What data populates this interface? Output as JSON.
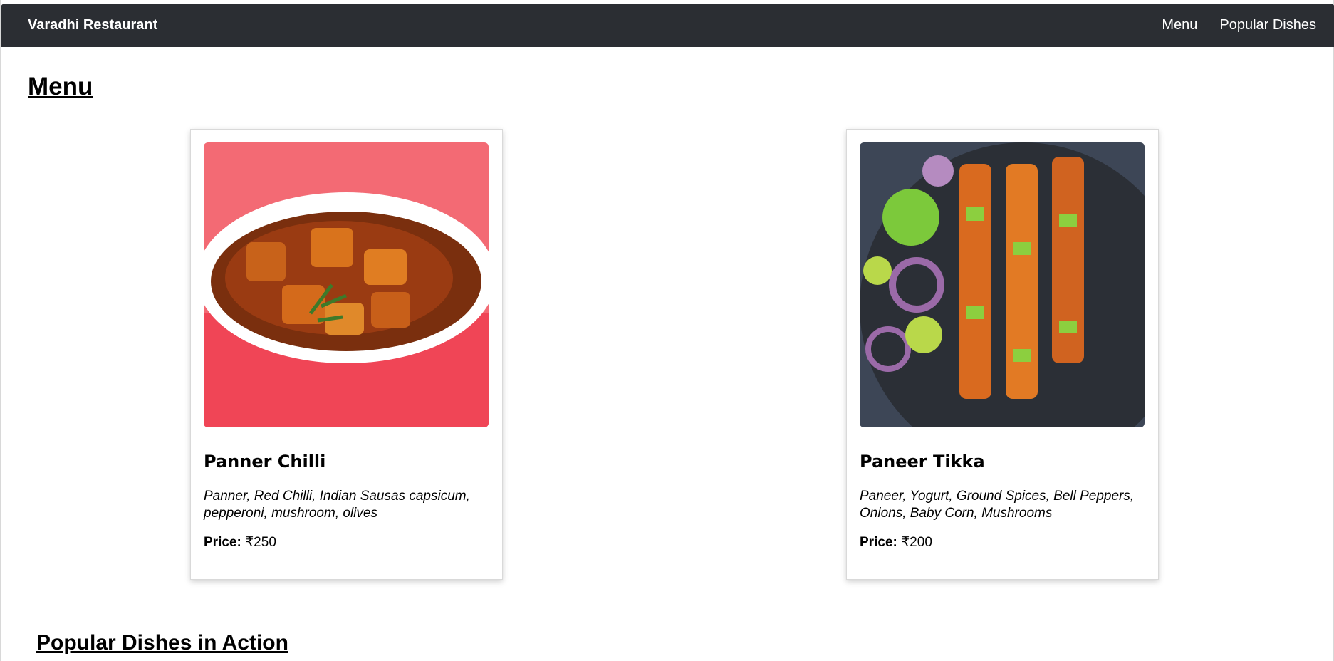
{
  "navbar": {
    "brand": "Varadhi Restaurant",
    "links": [
      "Menu",
      "Popular Dishes"
    ]
  },
  "menu_section": {
    "title": "Menu",
    "items": [
      {
        "name": "Panner Chilli",
        "ingredients": "Panner, Red Chilli, Indian Sausas capsicum, pepperoni, mushroom, olives",
        "price_label": "Price:",
        "price": "₹250"
      },
      {
        "name": "Paneer Tikka",
        "ingredients": "Paneer, Yogurt, Ground Spices, Bell Peppers, Onions, Baby Corn, Mushrooms",
        "price_label": "Price:",
        "price": "₹200"
      }
    ]
  },
  "popular_section": {
    "title": "Popular Dishes in Action"
  },
  "colors": {
    "navbar_bg": "#2b2e33",
    "navbar_text": "#ffffff"
  }
}
